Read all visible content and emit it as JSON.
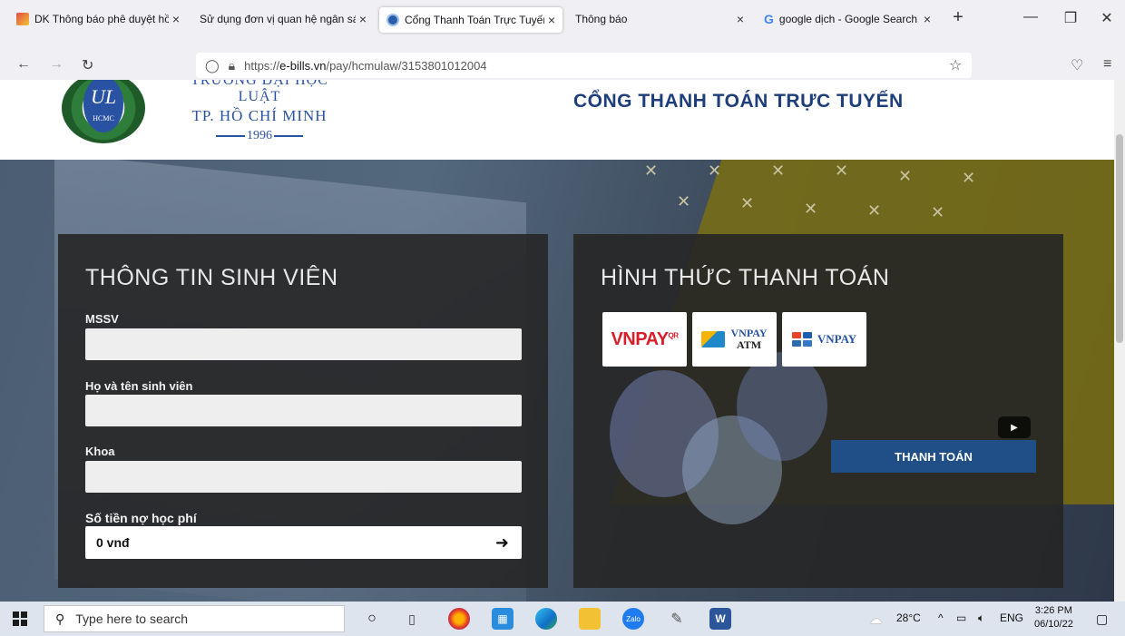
{
  "browser": {
    "tabs": [
      {
        "label": "DK Thông báo phê duyệt hồ",
        "icon": "app-favicon"
      },
      {
        "label": "Sử dụng đơn vị quan hệ ngân sác",
        "icon": "none"
      },
      {
        "label": "Cổng Thanh Toán Trực Tuyến",
        "icon": "university-favicon",
        "active": true
      },
      {
        "label": "Thông báo",
        "icon": "none"
      },
      {
        "label": "google dịch - Google Search",
        "icon": "google-favicon"
      }
    ],
    "tab_close": "×",
    "new_tab": "+",
    "window_controls": {
      "minimize": "—",
      "restore": "❐",
      "close": "✕"
    },
    "nav": {
      "back": "←",
      "forward": "→",
      "reload": "↻"
    },
    "url_prefix": "https://",
    "url_host": "e-bills.vn",
    "url_path": "/pay/hcmulaw/3153801012004",
    "bookmark_star": "☆",
    "pocket": "♡",
    "menu": "≡"
  },
  "header": {
    "school_line1": "TRƯỜNG ĐẠI HỌC LUẬT",
    "school_line2": "TP. HỒ CHÍ MINH",
    "school_year": "1996",
    "logo_text": "HCMC",
    "portal_title": "CỔNG THANH TOÁN TRỰC TUYẾN"
  },
  "student_panel": {
    "title": "THÔNG TIN SINH VIÊN",
    "fields": [
      {
        "label": "MSSV",
        "value": ""
      },
      {
        "label": "Họ và tên sinh viên",
        "value": ""
      },
      {
        "label": "Khoa",
        "value": ""
      }
    ],
    "debt_label": "Số tiền nợ học phí",
    "debt_value": "0 vnđ",
    "arrow": "➜"
  },
  "payment_panel": {
    "title": "HÌNH THỨC THANH TOÁN",
    "options": [
      {
        "name": "VNPAY",
        "suffix": "QR"
      },
      {
        "name": "VNPAY",
        "sub": "ATM"
      },
      {
        "name": "VNPAY"
      }
    ],
    "pay_button": "THANH TOÁN",
    "yt": "▶"
  },
  "taskbar": {
    "search_placeholder": "Type here to search",
    "weather": "28°C",
    "language": "ENG",
    "time": "3:26 PM",
    "date": "06/10/22",
    "tray_symbols": "^",
    "zalo": "Zalo",
    "word": "W"
  }
}
